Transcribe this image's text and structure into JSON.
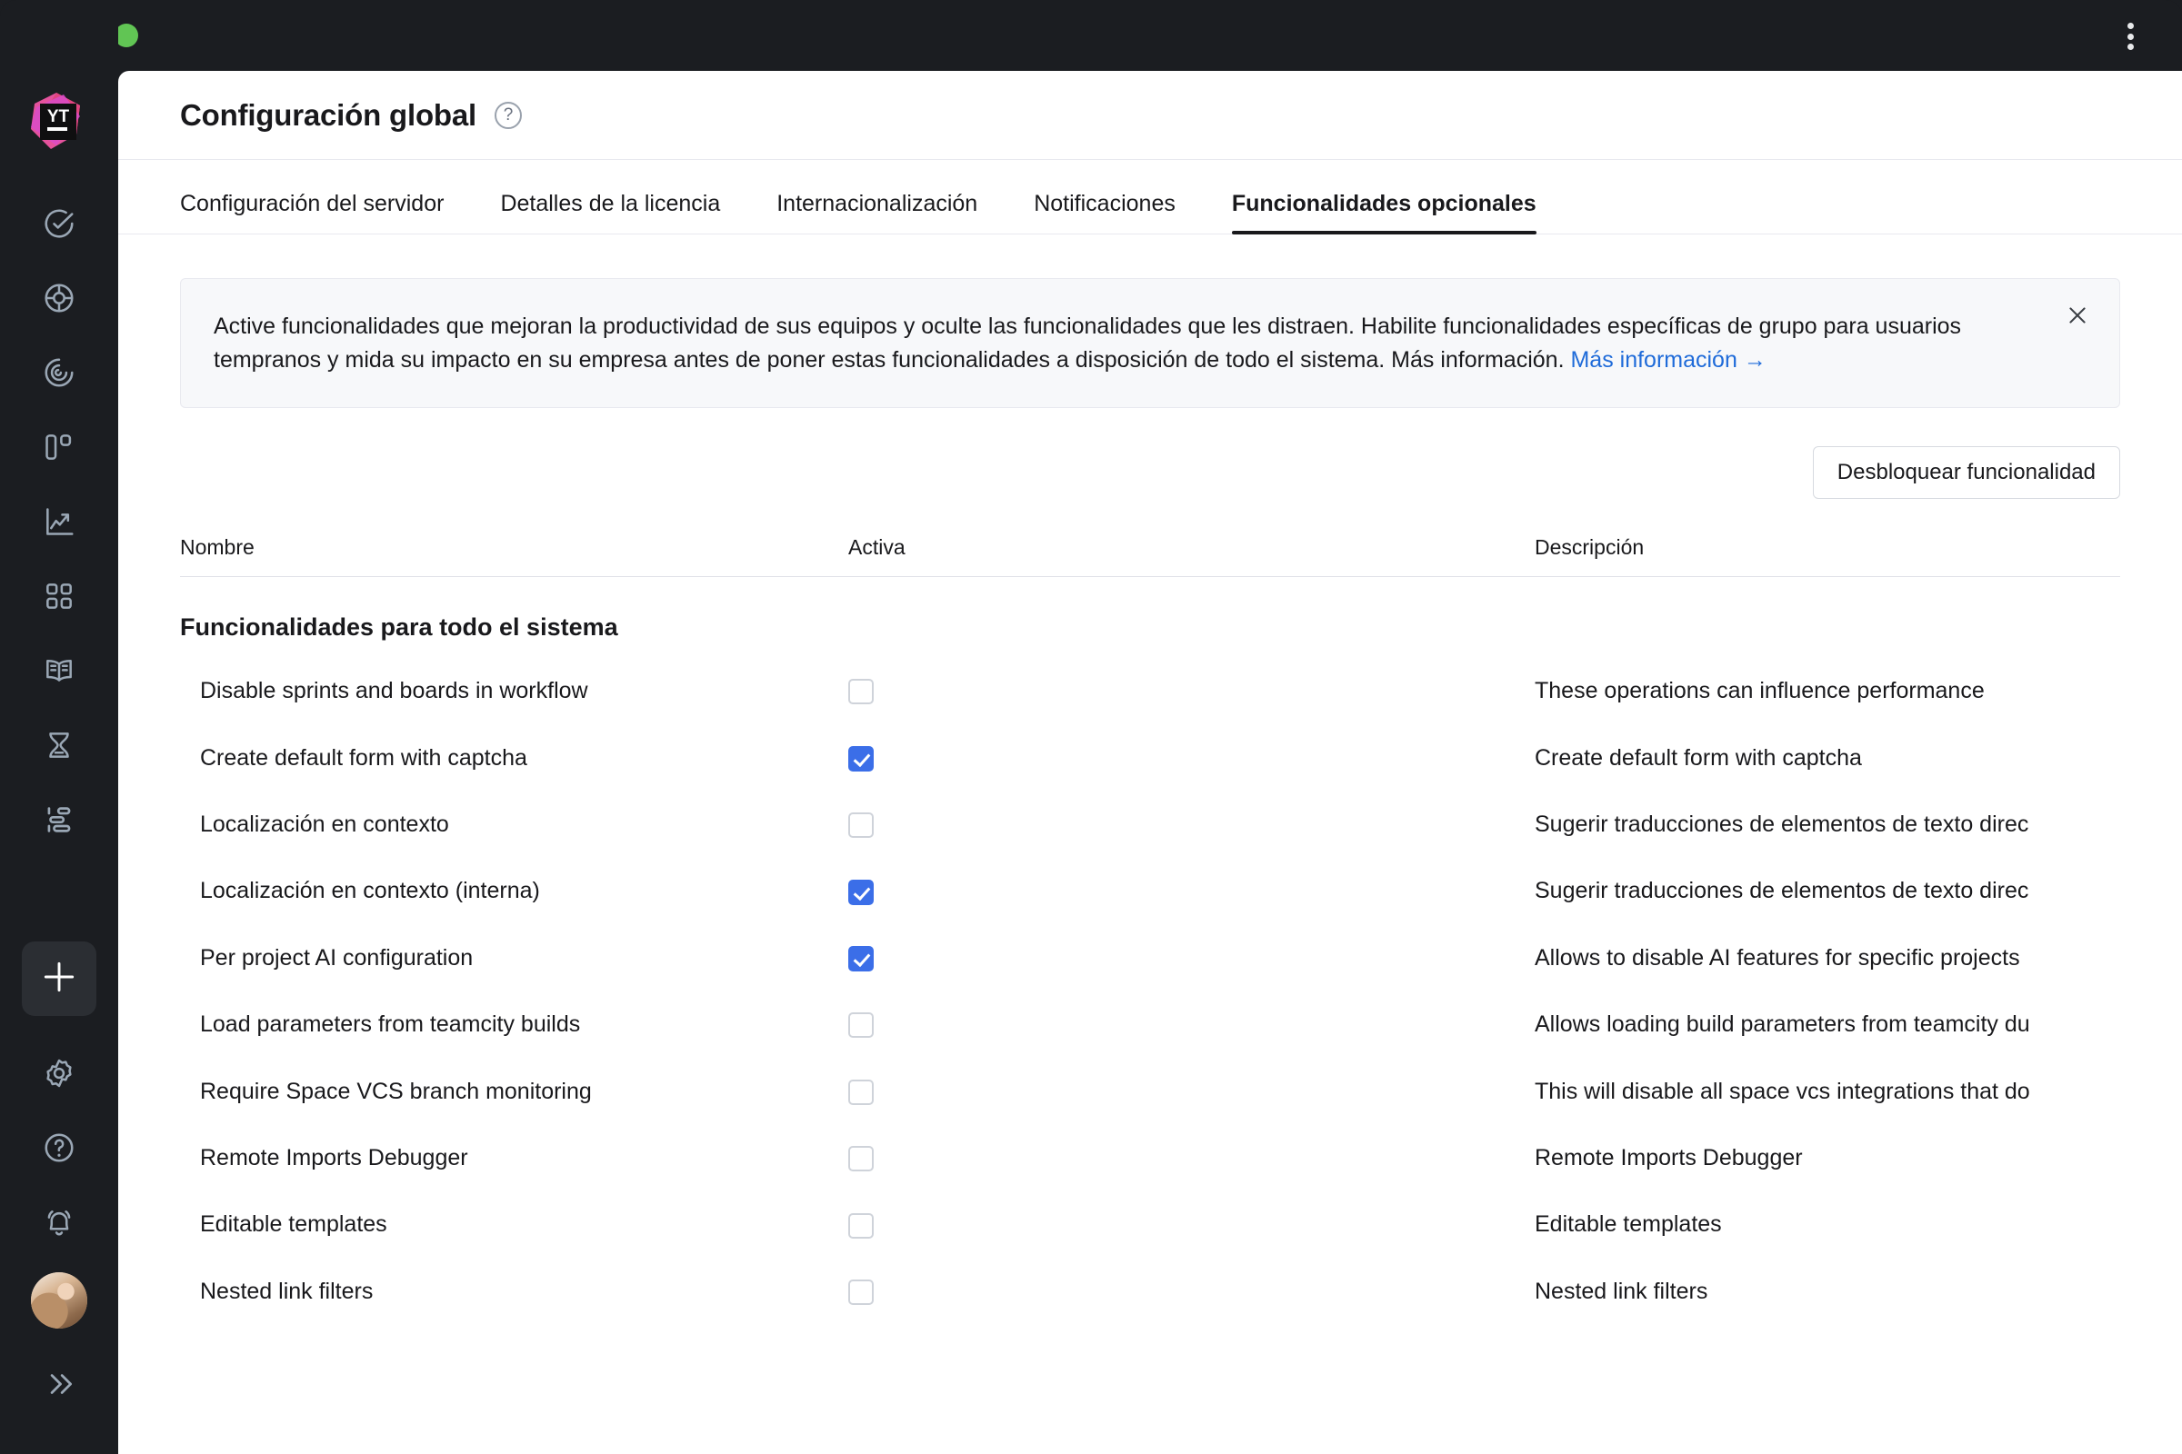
{
  "window": {
    "traffic_lights": [
      "close",
      "minimize",
      "maximize"
    ],
    "menu_icon": "kebab-menu-icon"
  },
  "sidebar": {
    "logo": "youtrack-logo",
    "top_items": [
      {
        "name": "issues",
        "icon": "check-circle-icon"
      },
      {
        "name": "agile-boards",
        "icon": "target-icon"
      },
      {
        "name": "reports",
        "icon": "spiral-icon"
      },
      {
        "name": "boards",
        "icon": "columns-icon"
      },
      {
        "name": "analytics",
        "icon": "chart-line-up-icon"
      },
      {
        "name": "dashboards",
        "icon": "grid-squares-icon"
      },
      {
        "name": "knowledge-base",
        "icon": "book-open-icon"
      },
      {
        "name": "time-tracking",
        "icon": "hourglass-icon"
      },
      {
        "name": "gantt",
        "icon": "bars-stagger-icon"
      }
    ],
    "bottom_items": [
      {
        "name": "create",
        "icon": "plus-icon"
      },
      {
        "name": "settings",
        "icon": "gear-icon"
      },
      {
        "name": "help",
        "icon": "question-circle-icon"
      },
      {
        "name": "notifications",
        "icon": "bell-icon"
      },
      {
        "name": "profile",
        "icon": "avatar"
      },
      {
        "name": "expand-sidebar",
        "icon": "chevron-double-right-icon"
      }
    ]
  },
  "header": {
    "title": "Configuración global",
    "help_glyph": "?"
  },
  "tabs": [
    {
      "label": "Configuración del servidor",
      "active": false
    },
    {
      "label": "Detalles de la licencia",
      "active": false
    },
    {
      "label": "Internacionalización",
      "active": false
    },
    {
      "label": "Notificaciones",
      "active": false
    },
    {
      "label": "Funcionalidades opcionales",
      "active": true
    }
  ],
  "banner": {
    "text": "Active funcionalidades que mejoran la productividad de sus equipos y oculte las funcionalidades que les distraen. Habilite funcionalidades específicas de grupo para usuarios tempranos y mida su impacto en su empresa antes de poner estas funcionalidades a disposición de todo el sistema. Más información. ",
    "link_text": "Más información →",
    "close_icon": "close-icon",
    "link_color": "#1f6bd9",
    "background": "#f7f8fa"
  },
  "toolbar": {
    "unlock_label": "Desbloquear funcionalidad"
  },
  "table": {
    "columns": {
      "name": "Nombre",
      "active": "Activa",
      "description": "Descripción"
    },
    "group_title": "Funcionalidades para todo el sistema",
    "rows": [
      {
        "name": "Disable sprints and boards in workflow",
        "active": false,
        "description": "These operations can influence performance"
      },
      {
        "name": "Create default form with captcha",
        "active": true,
        "description": "Create default form with captcha"
      },
      {
        "name": "Localización en contexto",
        "active": false,
        "description": "Sugerir traducciones de elementos de texto direc"
      },
      {
        "name": "Localización en contexto (interna)",
        "active": true,
        "description": "Sugerir traducciones de elementos de texto direc"
      },
      {
        "name": "Per project AI configuration",
        "active": true,
        "description": "Allows to disable AI features for specific projects"
      },
      {
        "name": "Load parameters from teamcity builds",
        "active": false,
        "description": "Allows loading build parameters from teamcity du"
      },
      {
        "name": "Require Space VCS branch monitoring",
        "active": false,
        "description": "This will disable all space vcs integrations that do"
      },
      {
        "name": "Remote Imports Debugger",
        "active": false,
        "description": "Remote Imports Debugger"
      },
      {
        "name": "Editable templates",
        "active": false,
        "description": "Editable templates"
      },
      {
        "name": "Nested link filters",
        "active": false,
        "description": "Nested link filters"
      }
    ]
  },
  "colors": {
    "accent_checkbox": "#3b6ee8",
    "sidebar_bg": "#1b1d21",
    "panel_bg": "#ffffff"
  }
}
